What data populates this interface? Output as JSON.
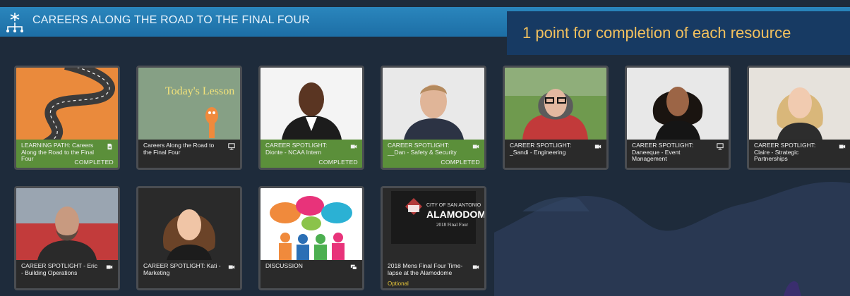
{
  "header": {
    "title": "CAREERS ALONG THE ROAD TO THE FINAL FOUR",
    "logo_icon": "network-logo-icon"
  },
  "points_banner": "1 point for completion of each resource",
  "cards": [
    {
      "title": "LEARNING PATH: Careers Along the Road to the Final Four",
      "type_icon": "document-icon",
      "status": "COMPLETED",
      "completed": true,
      "thumbnail": "winding-road-illustration"
    },
    {
      "title": "Careers Along the Road to the Final Four",
      "type_icon": "presentation-icon",
      "status": "",
      "completed": false,
      "thumbnail": "chalkboard-todays-lesson",
      "thumbnail_text": "Today's Lesson"
    },
    {
      "title": "CAREER SPOTLIGHT: Dionte - NCAA Intern",
      "type_icon": "video-icon",
      "status": "COMPLETED",
      "completed": true,
      "thumbnail": "portrait-man-suit"
    },
    {
      "title": "CAREER SPOTLIGHT: __Dan - Safety & Security",
      "type_icon": "video-icon",
      "status": "COMPLETED",
      "completed": true,
      "thumbnail": "portrait-man-smiling"
    },
    {
      "title": "CAREER SPOTLIGHT: _Sandi - Engineering",
      "type_icon": "video-icon",
      "status": "",
      "completed": false,
      "thumbnail": "portrait-woman-glasses-field"
    },
    {
      "title": "CAREER SPOTLIGHT: Daneeque - Event Management",
      "type_icon": "presentation-icon",
      "status": "",
      "completed": false,
      "thumbnail": "portrait-woman-curly-hair"
    },
    {
      "title": "CAREER SPOTLIGHT: Claire - Strategic Partnerships",
      "type_icon": "video-icon",
      "status": "",
      "completed": false,
      "thumbnail": "portrait-woman-blonde"
    },
    {
      "title": "CAREER SPOTLIGHT - Eric - Building Operations",
      "type_icon": "video-icon",
      "status": "",
      "completed": false,
      "thumbnail": "portrait-man-stadium"
    },
    {
      "title": "CAREER SPOTLIGHT: Kati - Marketing",
      "type_icon": "video-icon",
      "status": "",
      "completed": false,
      "thumbnail": "portrait-woman-wavy-hair"
    },
    {
      "title": "DISCUSSION",
      "type_icon": "chat-icon",
      "status": "",
      "completed": false,
      "thumbnail": "speech-bubbles-people"
    },
    {
      "title": "2018 Mens Final Four Time-lapse at the Alamodome",
      "type_icon": "video-icon",
      "status": "",
      "completed": false,
      "optional": "Optional",
      "thumbnail": "alamodome-logo",
      "logo_text": {
        "line1": "CITY OF SAN ANTONIO",
        "line2": "ALAMODOME",
        "line3": "2018 Final Four"
      }
    }
  ],
  "colors": {
    "header": "#1f75ad",
    "banner": "#173a63",
    "banner_text": "#f3c15e",
    "completed": "#5b8f3a",
    "optional": "#e7c63a"
  }
}
